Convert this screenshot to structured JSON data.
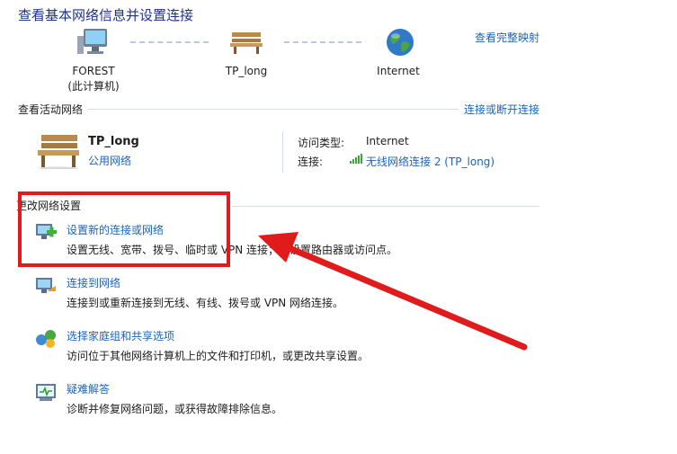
{
  "header": {
    "title": "查看基本网络信息并设置连接",
    "full_map_link": "查看完整映射"
  },
  "network_map": {
    "nodes": [
      {
        "name": "FOREST",
        "sub": "(此计算机)",
        "icon": "computer-icon"
      },
      {
        "name": "TP_long",
        "sub": "",
        "icon": "bench-network-icon"
      },
      {
        "name": "Internet",
        "sub": "",
        "icon": "globe-icon"
      }
    ]
  },
  "active_networks": {
    "heading": "查看活动网络",
    "connect_link": "连接或断开连接",
    "network": {
      "name": "TP_long",
      "type": "公用网络",
      "access_type_label": "访问类型:",
      "access_type_value": "Internet",
      "connections_label": "连接:",
      "connections_value": "无线网络连接 2 (TP_long)"
    }
  },
  "change_settings": {
    "heading": "更改网络设置",
    "tasks": [
      {
        "title": "设置新的连接或网络",
        "desc": "设置无线、宽带、拨号、临时或 VPN 连接；或设置路由器或访问点。",
        "icon": "new-connection-icon"
      },
      {
        "title": "连接到网络",
        "desc": "连接到或重新连接到无线、有线、拨号或 VPN 网络连接。",
        "icon": "connect-network-icon"
      },
      {
        "title": "选择家庭组和共享选项",
        "desc": "访问位于其他网络计算机上的文件和打印机，或更改共享设置。",
        "icon": "homegroup-icon"
      },
      {
        "title": "疑难解答",
        "desc": "诊断并修复网络问题，或获得故障排除信息。",
        "icon": "troubleshoot-icon"
      }
    ]
  },
  "colors": {
    "link": "#1e64b4",
    "title": "#1e3287",
    "annotation_red": "#e01b1b"
  }
}
